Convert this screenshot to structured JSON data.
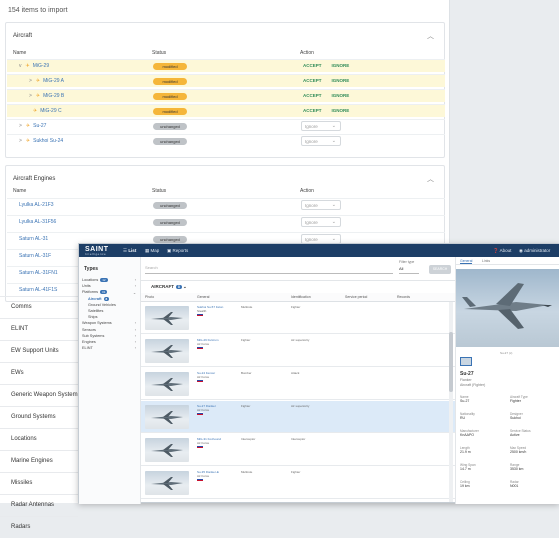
{
  "import_header": {
    "count_text": "154 items to import"
  },
  "aircraft_section": {
    "title": "Aircraft",
    "columns": {
      "name": "Name",
      "status": "Status",
      "action": "Action"
    },
    "rows": [
      {
        "name": "MiG-29",
        "status": "modified",
        "kind": "mod",
        "indent": 0,
        "expand": "v",
        "hl": true,
        "actions": [
          "ACCEPT",
          "IGNORE"
        ]
      },
      {
        "name": "MiG-29 A",
        "status": "modified",
        "kind": "mod",
        "indent": 1,
        "expand": ">",
        "hl": true,
        "actions": [
          "ACCEPT",
          "IGNORE"
        ]
      },
      {
        "name": "MiG-29 B",
        "status": "modified",
        "kind": "mod",
        "indent": 1,
        "expand": ">",
        "hl": true,
        "actions": [
          "ACCEPT",
          "IGNORE"
        ]
      },
      {
        "name": "MiG-29 C",
        "status": "modified",
        "kind": "mod",
        "indent": 1,
        "expand": "",
        "hl": true,
        "actions": [
          "ACCEPT",
          "IGNORE"
        ]
      },
      {
        "name": "Su-27",
        "status": "unchanged",
        "kind": "unc",
        "indent": 0,
        "expand": ">",
        "hl": false,
        "ignore": "Ignore"
      },
      {
        "name": "Sukhoi Su-24",
        "status": "unchanged",
        "kind": "unc",
        "indent": 0,
        "expand": ">",
        "hl": false,
        "ignore": "Ignore"
      }
    ]
  },
  "engines_section": {
    "title": "Aircraft Engines",
    "columns": {
      "name": "Name",
      "status": "Status",
      "action": "Action"
    },
    "rows": [
      {
        "name": "Lyulka AL-21F3",
        "status": "unchanged",
        "ignore": "Ignore"
      },
      {
        "name": "Lyulka AL-31F56",
        "status": "unchanged",
        "ignore": "Ignore"
      },
      {
        "name": "Saturn AL-31",
        "status": "unchanged",
        "ignore": "Ignore"
      },
      {
        "name": "Saturn AL-31F",
        "status": "unchanged",
        "ignore": "Ignore"
      },
      {
        "name": "Saturn AL-31FN1",
        "status": "unchanged",
        "ignore": "Ignore"
      },
      {
        "name": "Saturn AL-41F1S",
        "status": "unchanged",
        "ignore": "Ignore"
      }
    ]
  },
  "left_nav": [
    "Comms",
    "ELINT",
    "EW Support Units",
    "EWs",
    "Generic Weapon System",
    "Ground Systems",
    "Locations",
    "Marine Engines",
    "Missiles",
    "Radar Antennas",
    "Radars"
  ],
  "app": {
    "logo": "SAINT",
    "logo_sub": "Intelligence",
    "nav": {
      "list": "List",
      "map": "Map",
      "reports": "Reports"
    },
    "right": {
      "about": "About",
      "user": "administrator"
    },
    "types_title": "Types",
    "types": [
      {
        "label": "Locations",
        "count": "12",
        "arrow": "›"
      },
      {
        "label": "Units",
        "count": "",
        "arrow": "›"
      },
      {
        "label": "Platforms",
        "count": "31",
        "arrow": "⌄"
      },
      {
        "label": "Aircraft",
        "count": "8",
        "arrow": "",
        "sel": true
      },
      {
        "label": "Ground Vehicles",
        "count": "",
        "arrow": ""
      },
      {
        "label": "Satellites",
        "count": "",
        "arrow": ""
      },
      {
        "label": "Ships",
        "count": "",
        "arrow": ""
      },
      {
        "label": "Weapon Systems",
        "count": "",
        "arrow": "›"
      },
      {
        "label": "Sensors",
        "count": "",
        "arrow": "›"
      },
      {
        "label": "Sub Systems",
        "count": "",
        "arrow": "›"
      },
      {
        "label": "Engines",
        "count": "",
        "arrow": "›"
      },
      {
        "label": "ELINT",
        "count": "",
        "arrow": "›"
      }
    ],
    "search_placeholder": "Search",
    "type_filter": {
      "label": "Filter type",
      "value": "All"
    },
    "search_button": "SEARCH",
    "result_label": "AIRCRAFT",
    "result_count": "8",
    "grid_cols": [
      "Photo",
      "General",
      "Identification",
      "Service period",
      "Records"
    ],
    "rows": [
      {
        "name": "Sukhoi Su-57 Felon",
        "group": "Stealth",
        "role": "Multirole",
        "desc": "Fighter"
      },
      {
        "name": "MiG-29 Fulcrum",
        "group": "Air Force",
        "role": "Fighter",
        "desc": "Air superiority"
      },
      {
        "name": "Su-24 Fencer",
        "group": "Air Force",
        "role": "Bomber",
        "desc": "Attack"
      },
      {
        "name": "Su-27 Flanker",
        "group": "Air Force",
        "role": "Fighter",
        "desc": "Air superiority"
      },
      {
        "name": "MiG-31 Foxhound",
        "group": "Air Force",
        "role": "Interceptor",
        "desc": "Interceptor"
      },
      {
        "name": "Su-35 Flanker-E",
        "group": "Air Force",
        "role": "Multirole",
        "desc": "Fighter"
      }
    ],
    "detail": {
      "tabs": [
        "General",
        "Links"
      ],
      "caption": "Su-27 (c)",
      "title": "Su-27",
      "sub1": "Flanker",
      "sub2": "Aircraft (Fighter)",
      "fields": [
        {
          "k": "Name",
          "v": "Su-27"
        },
        {
          "k": "Aircraft Type",
          "v": "Fighter"
        },
        {
          "k": "Nationality",
          "v": "RU"
        },
        {
          "k": "Designer",
          "v": "Sukhoi"
        },
        {
          "k": "Manufacturer",
          "v": "KnAAPO"
        },
        {
          "k": "Service Status",
          "v": "Active"
        },
        {
          "k": "Length",
          "v": "21.9 m"
        },
        {
          "k": "Max Speed",
          "v": "2500 km/h"
        },
        {
          "k": "Wing Span",
          "v": "14.7 m"
        },
        {
          "k": "Range",
          "v": "3530 km"
        },
        {
          "k": "Ceiling",
          "v": "19 km"
        },
        {
          "k": "Radar",
          "v": "N001"
        }
      ]
    }
  }
}
